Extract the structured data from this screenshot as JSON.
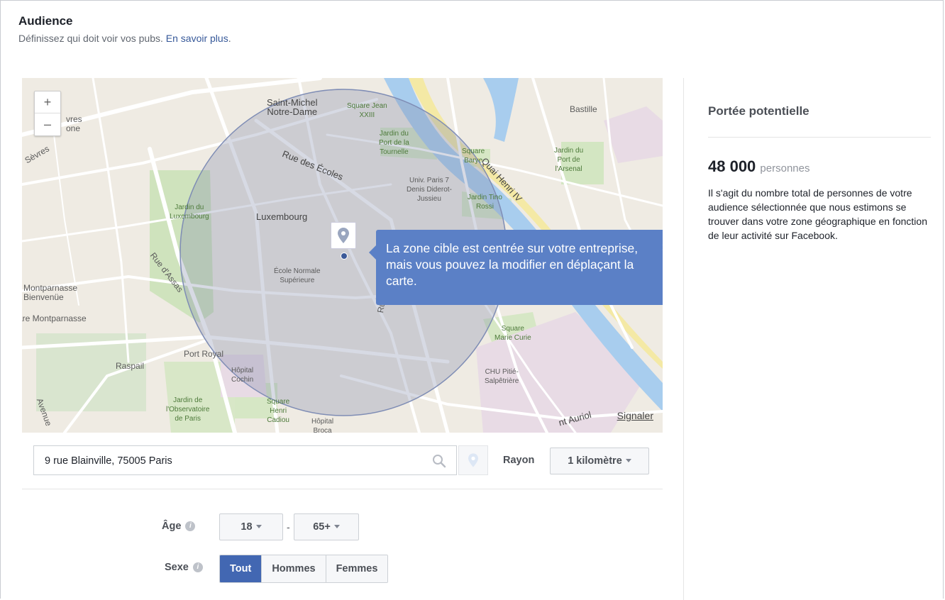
{
  "header": {
    "title": "Audience",
    "subtitle": "Définissez qui doit voir vos pubs.",
    "learn_more": "En savoir plus",
    "learn_more_suffix": "."
  },
  "map": {
    "zoom_in": "+",
    "zoom_out": "–",
    "tooltip_text": "La zone cible est centrée sur votre entreprise, mais vous pouvez la modifier en déplaçant la carte.",
    "tooltip_close": "×",
    "report_link": "Signaler",
    "radius_circle_color": "#8c9ab8",
    "labels": {
      "saint_michel": "Saint-Michel\nNotre-Dame",
      "square_jean": "Square Jean\nXXIII",
      "jardin_tournelle": "Jardin du\nPort de la\nTournelle",
      "square_barye": "Square\nBarye",
      "quai_henri": "Quai Henri IV",
      "bastille": "Bastille",
      "jardin_arsenal": "Jardin du\nPort de\nl'Arsenal",
      "sevres_top": "vres\none",
      "sevres": "Sèvres",
      "rue_ecoles": "Rue des Écoles",
      "univ_paris": "Univ. Paris 7\nDenis Diderot-\nJussieu",
      "jardin_tino": "Jardin Tino\nRossi",
      "jardin_luxembourg": "Jardin du\nLuxembourg",
      "luxembourg": "Luxembourg",
      "rue_assas": "Rue d'Assas",
      "ecole_normale": "École Normale\nSupérieure",
      "montparnasse": "Montparnasse\nBienvenüe",
      "gare_montparnasse": "are Montparnasse",
      "rue_right": "Rue",
      "square_marie": "Square\nMarie Curie",
      "raspail": "Raspail",
      "port_royal": "Port Royal",
      "hopital_cochin": "Hôpital\nCochin",
      "chu": "CHU Pitié-\nSalpêtrière",
      "jardin_observatoire": "Jardin de\nl'Observatoire\nde Paris",
      "square_cadiou": "Square\nHenri\nCadiou",
      "hopital_broca": "Hôpital\nBroca",
      "avenue": "Avenue",
      "auriol": "nt Auriol"
    }
  },
  "location": {
    "address_value": "9 rue Blainville, 75005 Paris",
    "radius_label": "Rayon",
    "radius_value": "1 kilomètre"
  },
  "age": {
    "label": "Âge",
    "min": "18",
    "separator": "-",
    "max": "65+"
  },
  "gender": {
    "label": "Sexe",
    "options": [
      "Tout",
      "Hommes",
      "Femmes"
    ],
    "selected": "Tout"
  },
  "reach": {
    "title": "Portée potentielle",
    "number": "48 000",
    "unit": "personnes",
    "description": "Il s'agit du nombre total de personnes de votre audience sélectionnée que nous estimons se trouver dans votre zone géographique en fonction de leur activité sur Facebook."
  },
  "colors": {
    "primary": "#4267b2",
    "tooltip": "#5b80c6",
    "link": "#365899"
  }
}
